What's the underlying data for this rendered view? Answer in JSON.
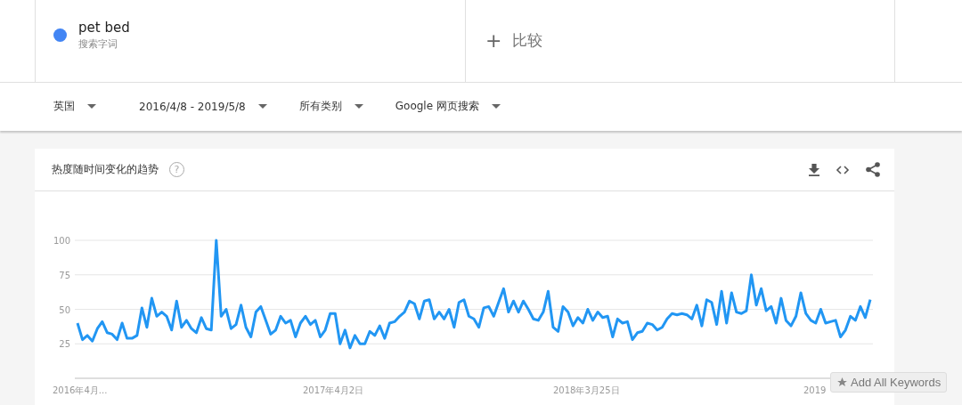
{
  "terms": [
    {
      "name": "pet bed",
      "type": "搜索字词",
      "color": "#4285f4"
    }
  ],
  "compare": {
    "symbol": "+",
    "label": "比较"
  },
  "filters": [
    {
      "label": "英国"
    },
    {
      "label": "2016/4/8 - 2019/5/8"
    },
    {
      "label": "所有类别"
    },
    {
      "label": "Google 网页搜索"
    }
  ],
  "card": {
    "title": "热度随时间变化的趋势",
    "help": "?",
    "chart_data": {
      "type": "line",
      "grid": true,
      "yticks": [
        25,
        50,
        75,
        100
      ],
      "ylim": [
        0,
        100
      ],
      "series": [
        {
          "color": "#2196f3",
          "values": [
            40,
            28,
            31,
            27,
            36,
            41,
            33,
            32,
            28,
            40,
            29,
            29,
            31,
            51,
            37,
            58,
            45,
            48,
            45,
            35,
            56,
            37,
            42,
            36,
            33,
            44,
            36,
            35,
            100,
            45,
            50,
            36,
            39,
            53,
            37,
            30,
            48,
            52,
            42,
            32,
            35,
            45,
            40,
            42,
            30,
            40,
            45,
            39,
            42,
            30,
            35,
            47,
            47,
            25,
            35,
            22,
            31,
            25,
            25,
            34,
            31,
            38,
            29,
            40,
            41,
            45,
            48,
            56,
            54,
            43,
            56,
            57,
            43,
            48,
            43,
            50,
            37,
            55,
            57,
            45,
            43,
            37,
            51,
            52,
            45,
            55,
            65,
            48,
            56,
            48,
            56,
            50,
            43,
            42,
            48,
            63,
            37,
            34,
            52,
            48,
            38,
            44,
            40,
            50,
            42,
            48,
            44,
            45,
            30,
            43,
            40,
            41,
            28,
            33,
            34,
            40,
            39,
            35,
            37,
            43,
            47,
            46,
            47,
            46,
            43,
            53,
            38,
            57,
            55,
            39,
            63,
            40,
            62,
            48,
            47,
            49,
            75,
            53,
            65,
            49,
            52,
            40,
            58,
            42,
            38,
            45,
            62,
            47,
            42,
            40,
            50,
            40,
            41,
            42,
            30,
            35,
            45,
            42,
            52,
            44,
            57
          ]
        }
      ]
    }
  },
  "x_axis_labels": [
    "2016年4月...",
    "2017年4月2日",
    "2018年3月25日",
    "2019"
  ],
  "extension_button": {
    "label": "Add All Keywords"
  }
}
